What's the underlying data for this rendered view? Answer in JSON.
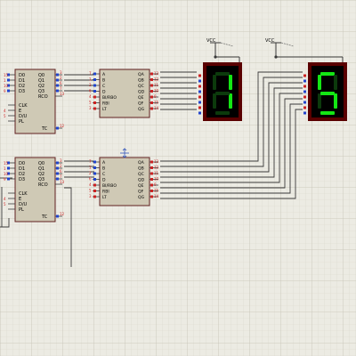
{
  "power": {
    "label": "VCC"
  },
  "counter_pins": {
    "inputs": [
      "D0",
      "D1",
      "D2",
      "D3"
    ],
    "outputs": [
      "Q0",
      "Q1",
      "Q2",
      "Q3"
    ],
    "rco": "RCO",
    "clk": "CLK",
    "e": "E",
    "dir": "D/U",
    "pl": "PL",
    "tc": "TC"
  },
  "counter_top": {
    "in_nums": [
      "15",
      "1",
      "10",
      "9"
    ],
    "out_nums": [
      "3",
      "2",
      "6",
      "7"
    ],
    "rco_num": "13",
    "e_num": "4",
    "dir_num": "5",
    "tc_num": "12"
  },
  "counter_bottom": {
    "in_nums": [
      "15",
      "1",
      "10",
      "9"
    ],
    "out_nums": [
      "3",
      "2",
      "6",
      "7"
    ],
    "rco_num": "13",
    "e_num": "4",
    "dir_num": "5",
    "tc_num": "12"
  },
  "decoder_pins": {
    "inputs": [
      "A",
      "B",
      "C",
      "D",
      "BI/RBO",
      "RBI",
      "LT"
    ],
    "outputs": [
      "QA",
      "QB",
      "QC",
      "QD",
      "QE",
      "QF",
      "QG"
    ]
  },
  "decoder_top": {
    "in_nums": [
      "7",
      "1",
      "2",
      "6",
      "4",
      "5",
      "3"
    ],
    "out_nums": [
      "13",
      "12",
      "11",
      "10",
      "9",
      "15",
      "14"
    ]
  },
  "decoder_bottom": {
    "in_nums": [
      "7",
      "1",
      "2",
      "6",
      "4",
      "5",
      "3"
    ],
    "out_nums": [
      "13",
      "12",
      "11",
      "10",
      "9",
      "15",
      "14"
    ]
  },
  "display_left": {
    "digit": "0",
    "lit_segments": [
      "b",
      "c"
    ]
  },
  "display_right": {
    "digit": "5",
    "lit_segments": [
      "a",
      "f",
      "g",
      "c",
      "d"
    ]
  },
  "colors": {
    "background": "#ecebe3",
    "grid": "#cfcdbf",
    "chip_fill": "#cfc9b5",
    "chip_border": "#5f1f1f",
    "wire": "#3a3a3a",
    "pin_red": "#cc2222",
    "pin_blue": "#2244cc",
    "seg_on": "#14e614",
    "seg_off": "#0c3a0c",
    "display_bg": "#000000",
    "display_frame": "#5a0000"
  }
}
